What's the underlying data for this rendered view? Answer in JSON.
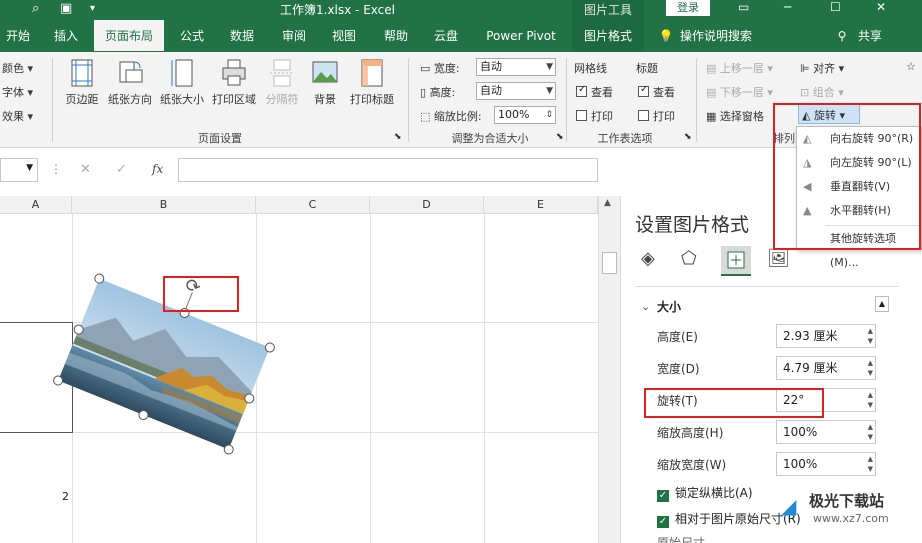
{
  "titlebar": {
    "doc_title": "工作簿1.xlsx  -  Excel",
    "context_tool": "图片工具",
    "login_label": "登录",
    "minimize": "─",
    "maximize": "☐",
    "close": "✕"
  },
  "tabs": {
    "home": "开始",
    "insert": "插入",
    "page_layout": "页面布局",
    "formulas": "公式",
    "data": "数据",
    "review": "审阅",
    "view": "视图",
    "help": "帮助",
    "cloud": "云盘",
    "power_pivot": "Power Pivot",
    "picture_format": "图片格式",
    "tell_me": "操作说明搜索",
    "share": "共享"
  },
  "ribbon": {
    "themes": {
      "colors": "颜色",
      "fonts": "字体",
      "effects": "效果"
    },
    "page_setup": {
      "margins": "页边距",
      "orientation": "纸张方向",
      "size": "纸张大小",
      "print_area": "打印区域",
      "breaks": "分隔符",
      "background": "背景",
      "print_titles": "打印标题",
      "group_label": "页面设置"
    },
    "scale_to_fit": {
      "width_label": "宽度:",
      "width_value": "自动",
      "height_label": "高度:",
      "height_value": "自动",
      "scale_label": "缩放比例:",
      "scale_value": "100%",
      "group_label": "调整为合适大小"
    },
    "sheet_options": {
      "gridlines": "网格线",
      "headings": "标题",
      "view": "查看",
      "print": "打印",
      "group_label": "工作表选项"
    },
    "arrange": {
      "bring_forward": "上移一层",
      "send_backward": "下移一层",
      "selection_pane": "选择窗格",
      "align": "对齐",
      "group": "组合",
      "rotate": "旋转",
      "group_label": "排列"
    }
  },
  "rotate_menu": {
    "items": [
      "向右旋转 90°(R)",
      "向左旋转 90°(L)",
      "垂直翻转(V)",
      "水平翻转(H)",
      "其他旋转选项(M)..."
    ]
  },
  "formula_bar": {
    "fx": "fx"
  },
  "columns": [
    "A",
    "B",
    "C",
    "D",
    "E"
  ],
  "rows": [
    "1",
    "2"
  ],
  "format_panel": {
    "title": "设置图片格式",
    "section_size": "大小",
    "height_label": "高度(E)",
    "height_value": "2.93 厘米",
    "width_label": "宽度(D)",
    "width_value": "4.79 厘米",
    "rotation_label": "旋转(T)",
    "rotation_value": "22°",
    "scale_height_label": "缩放高度(H)",
    "scale_height_value": "100%",
    "scale_width_label": "缩放宽度(W)",
    "scale_width_value": "100%",
    "lock_aspect_label": "锁定纵横比(A)",
    "relative_original_label": "相对于图片原始尺寸(R)",
    "original_size_label": "原始尺寸"
  },
  "watermark": {
    "name": "极光下载站",
    "url": "www.xz7.com"
  },
  "colors": {
    "accent": "#217346",
    "highlight": "#e02020"
  }
}
